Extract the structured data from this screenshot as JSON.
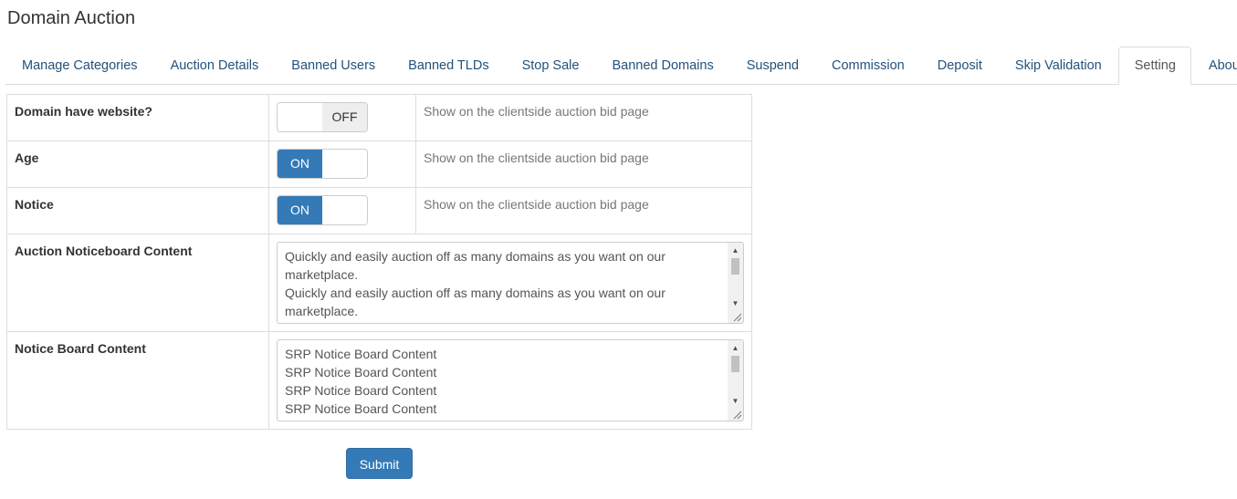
{
  "page": {
    "title": "Domain Auction"
  },
  "tabs": [
    {
      "label": "Manage Categories",
      "active": false
    },
    {
      "label": "Auction Details",
      "active": false
    },
    {
      "label": "Banned Users",
      "active": false
    },
    {
      "label": "Banned TLDs",
      "active": false
    },
    {
      "label": "Stop Sale",
      "active": false
    },
    {
      "label": "Banned Domains",
      "active": false
    },
    {
      "label": "Suspend",
      "active": false
    },
    {
      "label": "Commission",
      "active": false
    },
    {
      "label": "Deposit",
      "active": false
    },
    {
      "label": "Skip Validation",
      "active": false
    },
    {
      "label": "Setting",
      "active": true
    },
    {
      "label": "About",
      "active": false
    }
  ],
  "settings": {
    "website": {
      "label": "Domain have website?",
      "state": "OFF",
      "hint": "Show on the clientside auction bid page"
    },
    "age": {
      "label": "Age",
      "state": "ON",
      "hint": "Show on the clientside auction bid page"
    },
    "notice": {
      "label": "Notice",
      "state": "ON",
      "hint": "Show on the clientside auction bid page"
    },
    "auction_noticeboard": {
      "label": "Auction Noticeboard Content",
      "value": "Quickly and easily auction off as many domains as you want on our marketplace.\nQuickly and easily auction off as many domains as you want on our marketplace."
    },
    "notice_board": {
      "label": "Notice Board Content",
      "value": "SRP Notice Board Content\nSRP Notice Board Content\nSRP Notice Board Content\nSRP Notice Board Content"
    }
  },
  "actions": {
    "submit_label": "Submit"
  },
  "colors": {
    "primary": "#337ab7",
    "link": "#23527c",
    "border": "#dddddd"
  }
}
